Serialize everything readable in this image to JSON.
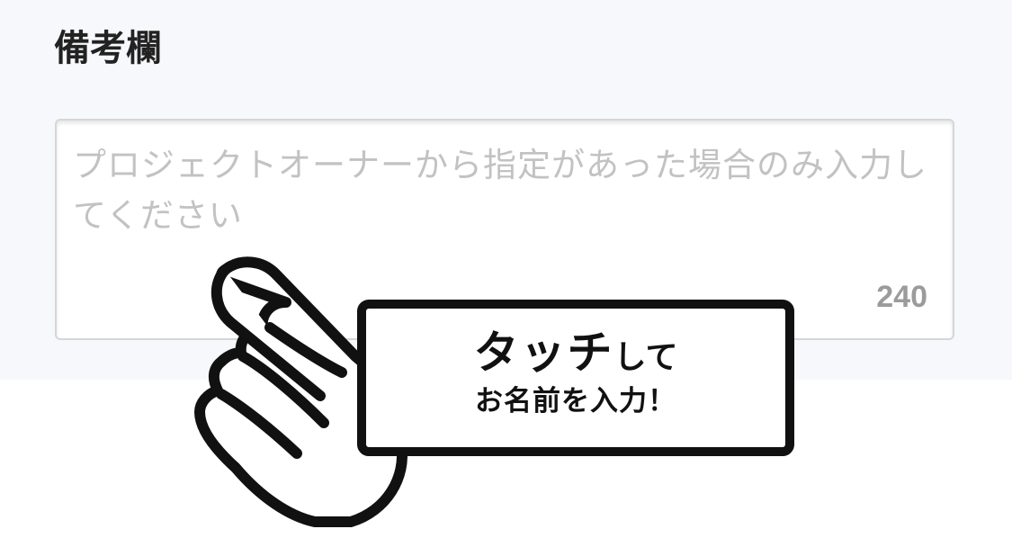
{
  "section": {
    "title": "備考欄"
  },
  "remarks": {
    "placeholder": "プロジェクトオーナーから指定があった場合のみ入力してください",
    "char_count": "240"
  },
  "callout": {
    "emphasis": "タッチ",
    "suffix": "して",
    "line2": "お名前を入力！"
  },
  "icons": {
    "hand": "pointing-hand-icon"
  }
}
